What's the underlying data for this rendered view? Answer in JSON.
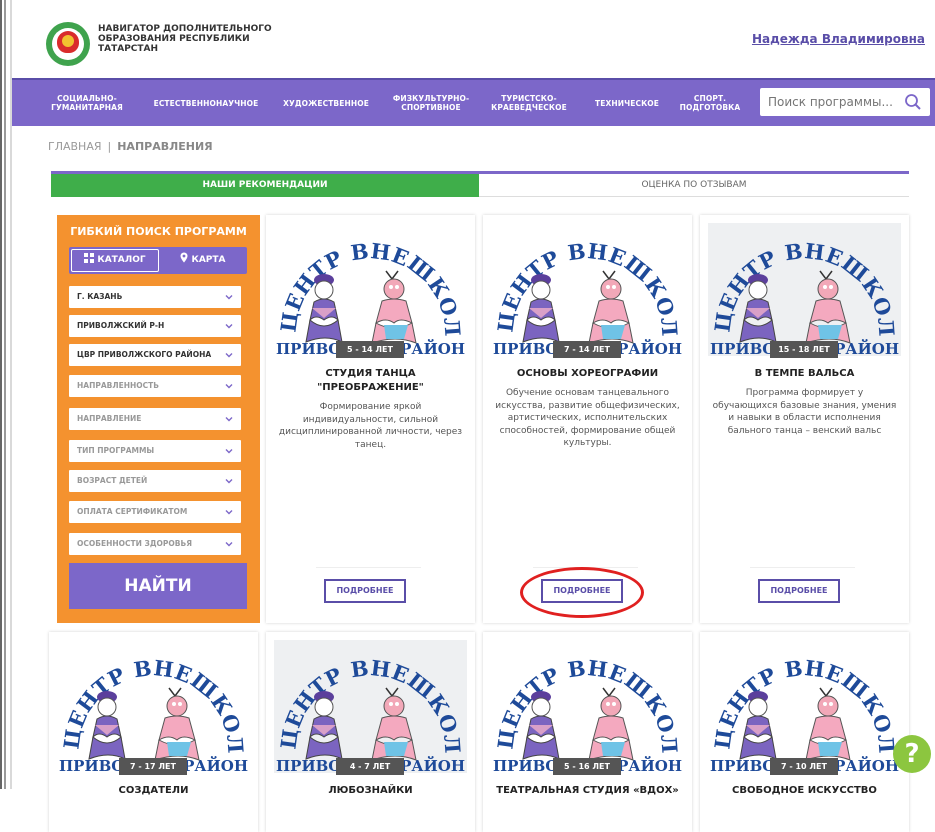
{
  "site": {
    "title": "НАВИГАТОР ДОПОЛНИТЕЛЬНОГО ОБРАЗОВАНИЯ РЕСПУБЛИКИ ТАТАРСТАН"
  },
  "user": {
    "name": "Надежда Владимировна"
  },
  "nav": {
    "items": [
      {
        "label": "СОЦИАЛЬНО-ГУМАНИТАРНАЯ"
      },
      {
        "label": "ЕСТЕСТВЕННОНАУЧНОЕ"
      },
      {
        "label": "ХУДОЖЕСТВЕННОЕ"
      },
      {
        "label": "ФИЗКУЛЬТУРНО-СПОРТИВНОЕ"
      },
      {
        "label": "ТУРИСТСКО-КРАЕВЕДЧЕСКОЕ"
      },
      {
        "label": "ТЕХНИЧЕСКОЕ"
      },
      {
        "label": "СПОРТ. ПОДГОТОВКА"
      }
    ],
    "search_placeholder": "Поиск программы..."
  },
  "breadcrumb": {
    "home": "ГЛАВНАЯ",
    "separator": "|",
    "current": "НАПРАВЛЕНИЯ"
  },
  "tabs": {
    "recommendations": "НАШИ РЕКОМЕНДАЦИИ",
    "reviews": "ОЦЕНКА ПО ОТЗЫВАМ"
  },
  "filter": {
    "title": "ГИБКИЙ ПОИСК ПРОГРАММ",
    "catalog_label": "КАТАЛОГ",
    "map_label": "КАРТА",
    "selects": [
      {
        "label": "Г. КАЗАНЬ"
      },
      {
        "label": "ПРИВОЛЖСКИЙ Р-Н"
      },
      {
        "label": "ЦВР ПРИВОЛЖСКОГО РАЙОНА"
      },
      {
        "label": "НАПРАВЛЕННОСТЬ"
      },
      {
        "label": "НАПРАВЛЕНИЕ"
      },
      {
        "label": "ТИП ПРОГРАММЫ"
      },
      {
        "label": "ВОЗРАСТ ДЕТЕЙ"
      },
      {
        "label": "ОПЛАТА СЕРТИФИКАТОМ"
      },
      {
        "label": "ОСОБЕННОСТИ ЗДОРОВЬЯ"
      }
    ],
    "find_label": "НАЙТИ"
  },
  "org_logo": {
    "arc_text": "ЦЕНТР ВНЕШКОЛЬНОЙ РАБОТЫ",
    "bottom_left": "ПРИВО",
    "bottom_right": "РАЙОН"
  },
  "cards": [
    {
      "age": "5 - 14 ЛЕТ",
      "title": "СТУДИЯ ТАНЦА \"ПРЕОБРАЖЕНИЕ\"",
      "description": "Формирование яркой индивидуальности, сильной дисциплинированной личности, через танец.",
      "more_label": "ПОДРОБНЕЕ"
    },
    {
      "age": "7 - 14 ЛЕТ",
      "title": "ОСНОВЫ ХОРЕОГРАФИИ",
      "description": "Обучение основам танцевального искусства, развитие общефизических, артистических, исполнительских способностей, формирование общей культуры.",
      "more_label": "ПОДРОБНЕЕ"
    },
    {
      "age": "15 - 18 ЛЕТ",
      "title": "В ТЕМПЕ ВАЛЬСА",
      "description": "Программа формирует у обучающихся базовые знания, умения и навыки в области исполнения бального танца – венский вальс",
      "more_label": "ПОДРОБНЕЕ"
    },
    {
      "age": "7 - 17 ЛЕТ",
      "title": "СОЗДАТЕЛИ"
    },
    {
      "age": "4 - 7 ЛЕТ",
      "title": "ЛЮБОЗНАЙКИ"
    },
    {
      "age": "5 - 16 ЛЕТ",
      "title": "ТЕАТРАЛЬНАЯ СТУДИЯ «ВДОХ»"
    },
    {
      "age": "7 - 10 ЛЕТ",
      "title": "СВОБОДНОЕ ИСКУССТВО"
    }
  ],
  "help": {
    "symbol": "?"
  }
}
